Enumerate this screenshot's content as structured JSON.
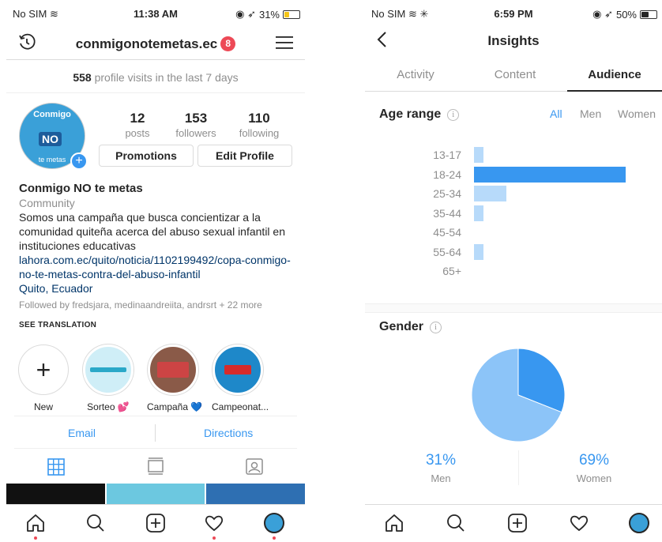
{
  "left": {
    "status": {
      "carrier": "No SIM",
      "time": "11:38 AM",
      "battery": "31%",
      "battery_level": 0.31
    },
    "header": {
      "username": "conmigonotemetas.ec",
      "notifications": "8"
    },
    "visits": {
      "count": "558",
      "text": "profile visits in the last 7 days"
    },
    "stats": [
      {
        "value": "12",
        "label": "posts"
      },
      {
        "value": "153",
        "label": "followers"
      },
      {
        "value": "110",
        "label": "following"
      }
    ],
    "avatar": {
      "line1": "Conmigo",
      "line2": "NO",
      "line3": "te metas"
    },
    "buttons": {
      "promotions": "Promotions",
      "edit_profile": "Edit Profile"
    },
    "bio": {
      "name": "Conmigo NO te metas",
      "category": "Community",
      "description": "Somos una campaña que busca concientizar a la comunidad quiteña acerca del abuso sexual infantil en instituciones educativas",
      "link": "lahora.com.ec/quito/noticia/1102199492/copa-conmigo-no-te-metas-contra-del-abuso-infantil",
      "location": "Quito, Ecuador",
      "followed_by": "Followed by fredsjara, medinaandreiita, andrsrt + 22 more",
      "see_translation": "SEE TRANSLATION"
    },
    "highlights": [
      {
        "label": "New"
      },
      {
        "label": "Sorteo 💕"
      },
      {
        "label": "Campaña 💙"
      },
      {
        "label": "Campeonat..."
      }
    ],
    "contact": {
      "email": "Email",
      "directions": "Directions"
    }
  },
  "right": {
    "status": {
      "carrier": "No SIM",
      "time": "6:59 PM",
      "battery": "50%",
      "battery_level": 0.5
    },
    "title": "Insights",
    "tabs": [
      "Activity",
      "Content",
      "Audience"
    ],
    "active_tab": "Audience",
    "age": {
      "title": "Age range",
      "filters": [
        "All",
        "Men",
        "Women"
      ],
      "active_filter": "All"
    },
    "gender": {
      "title": "Gender",
      "men_pct": "31%",
      "men_label": "Men",
      "women_pct": "69%",
      "women_label": "Women"
    }
  },
  "chart_data": [
    {
      "type": "bar",
      "orientation": "horizontal",
      "title": "Age range",
      "categories": [
        "13-17",
        "18-24",
        "25-34",
        "35-44",
        "45-54",
        "55-64",
        "65+"
      ],
      "values": [
        2,
        33,
        7,
        2,
        0,
        2,
        0
      ],
      "colors": [
        "#b7dafa",
        "#3897f0",
        "#b7dafa",
        "#b7dafa",
        "#b7dafa",
        "#b7dafa",
        "#b7dafa"
      ]
    },
    {
      "type": "pie",
      "title": "Gender",
      "labels": [
        "Men",
        "Women"
      ],
      "values": [
        31,
        69
      ],
      "colors": [
        "#3897f0",
        "#8cc4f8"
      ]
    }
  ]
}
